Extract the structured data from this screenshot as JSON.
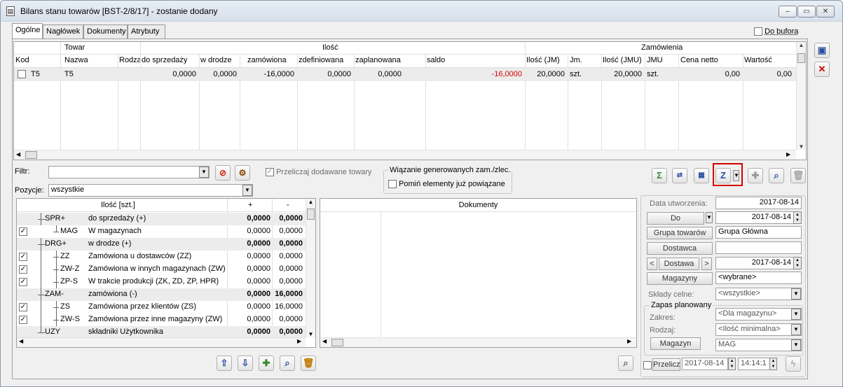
{
  "window": {
    "title": "Bilans stanu towarów [BST-2/8/17] - zostanie dodany",
    "controls": [
      "‒",
      "▭",
      "✕"
    ]
  },
  "tabs": [
    "Ogólne",
    "Nagłówek",
    "Dokumenty",
    "Atrybuty"
  ],
  "buffer_checkbox": "Do bufora",
  "top_grid": {
    "group_headers": {
      "towar": "Towar",
      "ilosc": "Ilość",
      "zamowienia": "Zamówienia"
    },
    "columns": [
      "Kod",
      "Nazwa",
      "Rodza",
      "do sprzedaży",
      "w drodze",
      "zamówiona",
      "zdefiniowana",
      "zaplanowana",
      "saldo",
      "Ilość (JM)",
      "Jm.",
      "Ilość (JMU)",
      "JMU",
      "Cena netto",
      "Wartość"
    ],
    "row": [
      "T5",
      "T5",
      "",
      "0,0000",
      "0,0000",
      "-16,0000",
      "0,0000",
      "0,0000",
      "-16,0000",
      "20,0000",
      "szt.",
      "20,0000",
      "szt.",
      "0,00",
      "0,00"
    ],
    "saldo_color": "#d40000"
  },
  "filter": {
    "label": "Filtr:",
    "value": ""
  },
  "recalc_checkbox": "Przeliczaj dodawane towary",
  "binding_group": {
    "title": "Wiązanie generowanych zam./zlec.",
    "checkbox": "Pomiń elementy już powiązane"
  },
  "positions": {
    "label": "Pozycje:",
    "value": "wszystkie"
  },
  "tree": {
    "headers": [
      "Ilość [szt.]",
      "+",
      "-"
    ],
    "rows": [
      {
        "code": "SPR+",
        "name": "do sprzedaży (+)",
        "plus": "0,0000",
        "minus": "0,0000",
        "bold": true,
        "checked": false,
        "level": 0
      },
      {
        "code": "MAG",
        "name": "W magazynach",
        "plus": "0,0000",
        "minus": "0,0000",
        "bold": false,
        "checked": true,
        "level": 1
      },
      {
        "code": "DRG+",
        "name": "w drodze (+)",
        "plus": "0,0000",
        "minus": "0,0000",
        "bold": true,
        "checked": false,
        "level": 0
      },
      {
        "code": "ZZ",
        "name": "Zamówiona u dostawców (ZZ)",
        "plus": "0,0000",
        "minus": "0,0000",
        "bold": false,
        "checked": true,
        "level": 1
      },
      {
        "code": "ZW-Z",
        "name": "Zamówiona w innych magazynach (ZW)",
        "plus": "0,0000",
        "minus": "0,0000",
        "bold": false,
        "checked": true,
        "level": 1
      },
      {
        "code": "ZP-S",
        "name": "W trakcie produkcji (ZK, ZD, ZP, HPR)",
        "plus": "0,0000",
        "minus": "0,0000",
        "bold": false,
        "checked": true,
        "level": 1
      },
      {
        "code": "ZAM-",
        "name": "zamówiona (-)",
        "plus": "0,0000",
        "minus": "16,0000",
        "bold": true,
        "checked": false,
        "level": 0
      },
      {
        "code": "ZS",
        "name": "Zamówiona przez klientów (ZS)",
        "plus": "0,0000",
        "minus": "16,0000",
        "bold": false,
        "checked": true,
        "level": 1
      },
      {
        "code": "ZW-S",
        "name": "Zamówiona przez inne magazyny (ZW)",
        "plus": "0,0000",
        "minus": "0,0000",
        "bold": false,
        "checked": true,
        "level": 1
      },
      {
        "code": "UZY",
        "name": "składniki Użytkownika",
        "plus": "0,0000",
        "minus": "0,0000",
        "bold": true,
        "checked": false,
        "level": 0
      }
    ]
  },
  "documents_header": "Dokumenty",
  "right_form": {
    "created_label": "Data utworzenia:",
    "created_value": "2017-08-14",
    "do_button": "Do",
    "do_value": "2017-08-14",
    "group_button": "Grupa towarów",
    "group_value": "Grupa Główna",
    "supplier_button": "Dostawca",
    "supplier_value": "",
    "delivery_button": "Dostawa",
    "delivery_value": "2017-08-14",
    "warehouses_button": "Magazyny",
    "warehouses_value": "<wybrane>",
    "customs_label": "Składy celne:",
    "customs_value": "<wszystkie>",
    "reserve_title": "Zapas planowany",
    "range_label": "Zakres:",
    "range_value": "<Dla magazynu>",
    "type_label": "Rodzaj:",
    "type_value": "<Ilość minimalna>",
    "warehouse_button": "Magazyn",
    "warehouse_value": "MAG",
    "recalc_label": "Przelicz",
    "recalc_date": "2017-08-14",
    "recalc_time": "14:14:1"
  },
  "icons": {
    "sigma": "Σ",
    "plus": "✚",
    "search": "🔍"
  },
  "colors": {
    "highlight_red": "#d40000",
    "green": "#2e8b2e"
  }
}
